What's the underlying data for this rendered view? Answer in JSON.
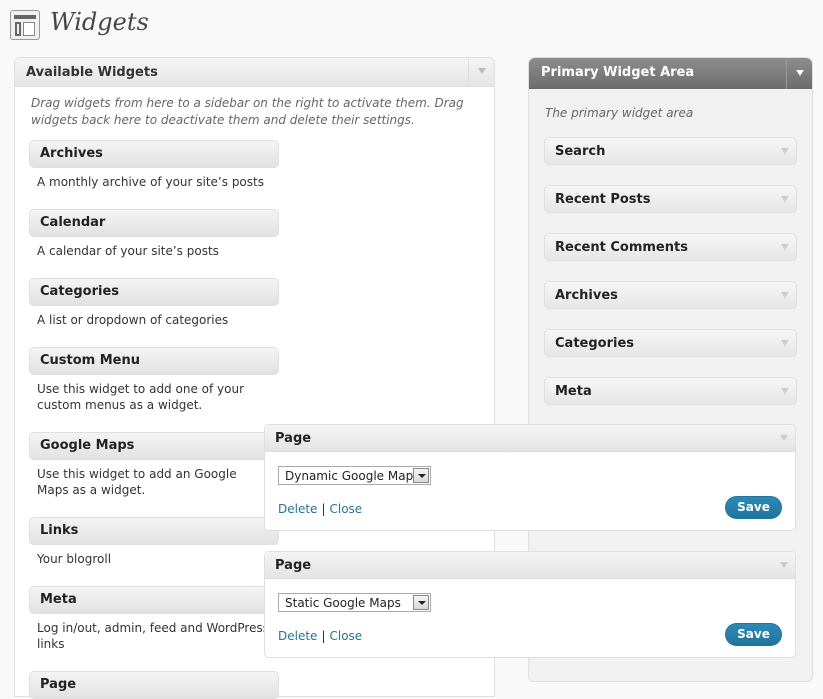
{
  "header": {
    "title": "Widgets",
    "icon": "widgets-layout-icon"
  },
  "available": {
    "title": "Available Widgets",
    "description": "Drag widgets from here to a sidebar on the right to activate them. Drag widgets back here to deactivate them and delete their settings.",
    "widgets": [
      {
        "name": "Archives",
        "desc": "A monthly archive of your site’s posts"
      },
      {
        "name": "Calendar",
        "desc": "A calendar of your site’s posts"
      },
      {
        "name": "Categories",
        "desc": "A list or dropdown of categories"
      },
      {
        "name": "Custom Menu",
        "desc": "Use this widget to add one of your custom menus as a widget."
      },
      {
        "name": "Google Maps",
        "desc": "Use this widget to add an Google Maps as a widget."
      },
      {
        "name": "Links",
        "desc": "Your blogroll"
      },
      {
        "name": "Meta",
        "desc": "Log in/out, admin, feed and WordPress links"
      },
      {
        "name": "Page",
        "desc": ""
      }
    ]
  },
  "primary": {
    "title": "Primary Widget Area",
    "description": "The primary widget area",
    "widgets": [
      "Search",
      "Recent Posts",
      "Recent Comments",
      "Archives",
      "Categories",
      "Meta"
    ]
  },
  "page_widgets": [
    {
      "title": "Page",
      "selected": "Dynamic Google Maps",
      "delete_label": "Delete",
      "close_label": "Close",
      "separator": "|",
      "save_label": "Save"
    },
    {
      "title": "Page",
      "selected": "Static Google Maps",
      "delete_label": "Delete",
      "close_label": "Close",
      "separator": "|",
      "save_label": "Save"
    }
  ],
  "colors": {
    "accent": "#21759b",
    "primary_head": "#7a7a7a"
  }
}
